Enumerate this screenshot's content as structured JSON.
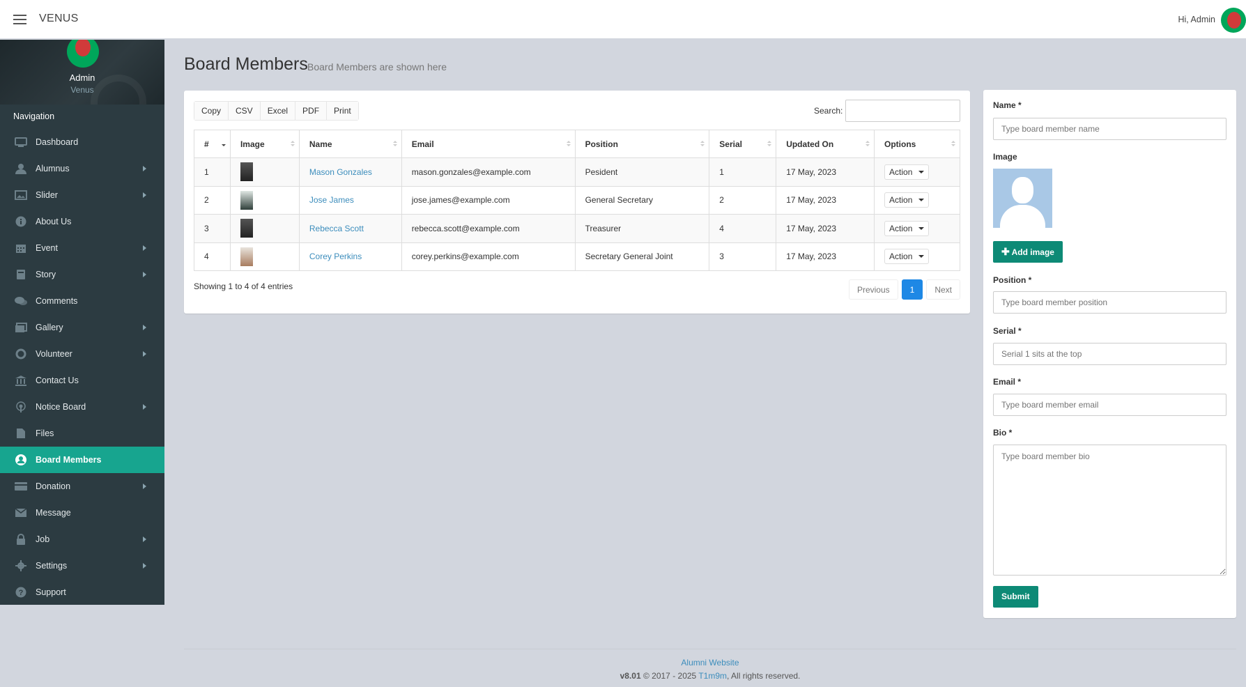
{
  "app": {
    "brand": "VENUS",
    "greeting": "Hi, Admin"
  },
  "sidebar": {
    "user_name": "Admin",
    "user_role": "Venus",
    "header": "Navigation",
    "items": [
      {
        "label": "Dashboard",
        "icon": "monitor-icon",
        "has_children": false
      },
      {
        "label": "Alumnus",
        "icon": "user-icon",
        "has_children": true
      },
      {
        "label": "Slider",
        "icon": "image-icon",
        "has_children": true
      },
      {
        "label": "About Us",
        "icon": "info-icon",
        "has_children": false
      },
      {
        "label": "Event",
        "icon": "calendar-icon",
        "has_children": true
      },
      {
        "label": "Story",
        "icon": "book-icon",
        "has_children": true
      },
      {
        "label": "Comments",
        "icon": "comments-icon",
        "has_children": false
      },
      {
        "label": "Gallery",
        "icon": "gallery-icon",
        "has_children": true
      },
      {
        "label": "Volunteer",
        "icon": "lifebuoy-icon",
        "has_children": true
      },
      {
        "label": "Contact Us",
        "icon": "building-icon",
        "has_children": false
      },
      {
        "label": "Notice Board",
        "icon": "broadcast-icon",
        "has_children": true
      },
      {
        "label": "Files",
        "icon": "file-icon",
        "has_children": false
      },
      {
        "label": "Board Members",
        "icon": "user-circle-icon",
        "has_children": false,
        "active": true
      },
      {
        "label": "Donation",
        "icon": "credit-card-icon",
        "has_children": true
      },
      {
        "label": "Message",
        "icon": "envelope-icon",
        "has_children": false
      },
      {
        "label": "Job",
        "icon": "lock-icon",
        "has_children": true
      },
      {
        "label": "Settings",
        "icon": "gear-icon",
        "has_children": true
      },
      {
        "label": "Support",
        "icon": "question-icon",
        "has_children": false
      }
    ]
  },
  "page": {
    "title": "Board Members",
    "subtitle": "Board Members are shown here"
  },
  "table": {
    "export_buttons": [
      "Copy",
      "CSV",
      "Excel",
      "PDF",
      "Print"
    ],
    "search_label": "Search:",
    "columns": [
      "#",
      "Image",
      "Name",
      "Email",
      "Position",
      "Serial",
      "Updated On",
      "Options"
    ],
    "rows": [
      {
        "num": "1",
        "name": "Mason Gonzales",
        "email": "mason.gonzales@example.com",
        "position": "Pesident",
        "serial": "1",
        "updated": "17 May, 2023",
        "action": "Action"
      },
      {
        "num": "2",
        "name": "Jose James",
        "email": "jose.james@example.com",
        "position": "General Secretary",
        "serial": "2",
        "updated": "17 May, 2023",
        "action": "Action"
      },
      {
        "num": "3",
        "name": "Rebecca Scott",
        "email": "rebecca.scott@example.com",
        "position": "Treasurer",
        "serial": "4",
        "updated": "17 May, 2023",
        "action": "Action"
      },
      {
        "num": "4",
        "name": "Corey Perkins",
        "email": "corey.perkins@example.com",
        "position": "Secretary General Joint",
        "serial": "3",
        "updated": "17 May, 2023",
        "action": "Action"
      }
    ],
    "info": "Showing 1 to 4 of 4 entries",
    "pager": {
      "prev": "Previous",
      "current": "1",
      "next": "Next"
    }
  },
  "form": {
    "name_label": "Name *",
    "name_placeholder": "Type board member name",
    "image_label": "Image",
    "add_image": "Add image",
    "position_label": "Position *",
    "position_placeholder": "Type board member position",
    "serial_label": "Serial *",
    "serial_placeholder": "Serial 1 sits at the top",
    "email_label": "Email *",
    "email_placeholder": "Type board member email",
    "bio_label": "Bio *",
    "bio_placeholder": "Type board member bio",
    "submit": "Submit"
  },
  "footer": {
    "site": "Alumni Website",
    "version": "v8.01",
    "copyright": "© 2017 - 2025",
    "author": "T1m9m",
    "rights": ", All rights reserved."
  },
  "colors": {
    "accent": "#17a58f",
    "sidebar": "#2c3b41",
    "link": "#3c8dbc",
    "primary": "#1e88e5",
    "button": "#0d8a76"
  }
}
